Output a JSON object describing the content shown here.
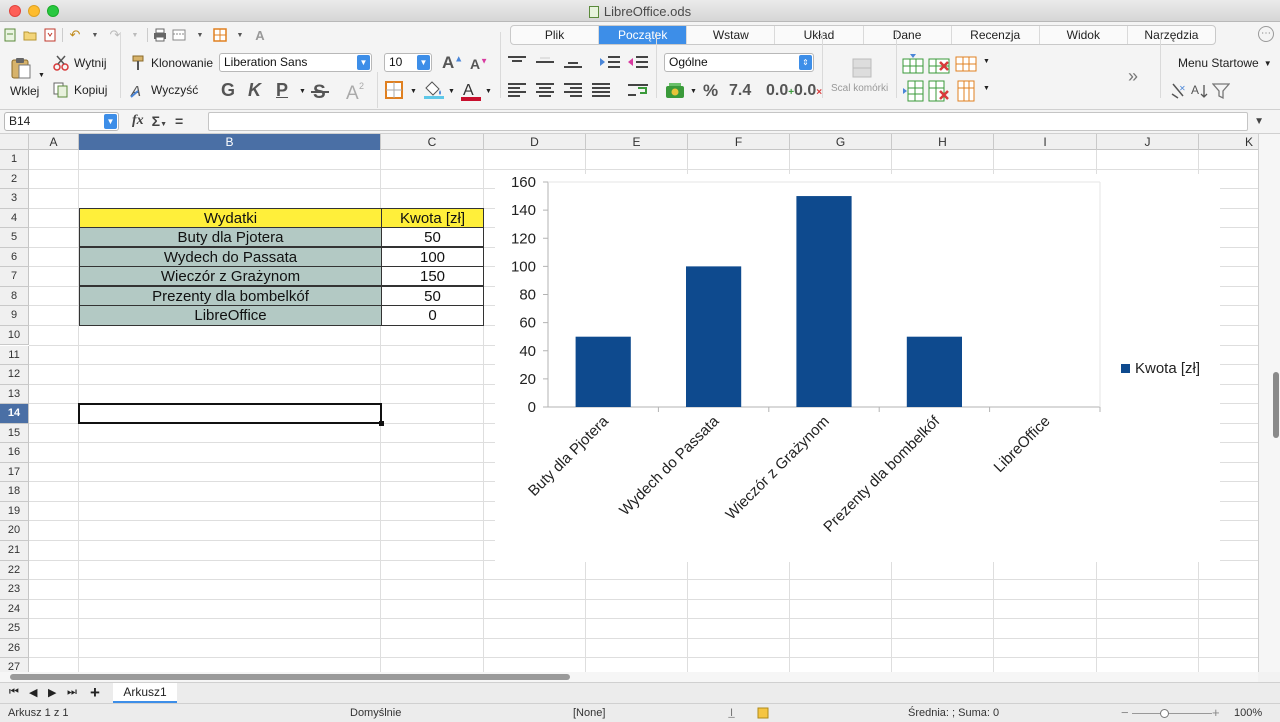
{
  "window": {
    "title": "LibreOffice.ods"
  },
  "tabs": [
    {
      "label": "Plik",
      "active": false
    },
    {
      "label": "Początek",
      "active": true
    },
    {
      "label": "Wstaw",
      "active": false
    },
    {
      "label": "Układ",
      "active": false
    },
    {
      "label": "Dane",
      "active": false
    },
    {
      "label": "Recenzja",
      "active": false
    },
    {
      "label": "Widok",
      "active": false
    },
    {
      "label": "Narzędzia",
      "active": false
    }
  ],
  "ribbon": {
    "paste_label": "Wklej",
    "cut_label": "Wytnij",
    "copy_label": "Kopiuj",
    "clone_label": "Klonowanie",
    "clear_label": "Wyczyść",
    "font_name": "Liberation Sans",
    "font_size": "10",
    "bold_glyph": "G",
    "italic_glyph": "K",
    "underline_glyph": "P",
    "number_format": "Ogólne",
    "percent_glyph": "%",
    "decimal_glyph": "7.4",
    "add_decimal_glyph": "0.0",
    "del_decimal_glyph": "0.0",
    "merge_label": "Scal komórki",
    "menu_start_label": "Menu Startowe",
    "more_glyph": "»"
  },
  "formula": {
    "cell_ref": "B14",
    "fx": "fx",
    "sigma": "Σ",
    "equals": "=",
    "content": ""
  },
  "grid": {
    "columns": [
      "A",
      "B",
      "C",
      "D",
      "E",
      "F",
      "G",
      "H",
      "I",
      "J",
      "K"
    ],
    "selected_column": "B",
    "rows": [
      "1",
      "2",
      "3",
      "4",
      "5",
      "6",
      "7",
      "8",
      "9",
      "10",
      "11",
      "12",
      "13",
      "14",
      "15",
      "16",
      "17",
      "18",
      "19",
      "20",
      "21",
      "22",
      "23",
      "24",
      "25",
      "26",
      "27"
    ],
    "selected_row": "14",
    "table": {
      "headers": [
        "Wydatki",
        "Kwota [zł]"
      ],
      "rows": [
        [
          "Buty dla Pjotera",
          "50"
        ],
        [
          "Wydech do Passata",
          "100"
        ],
        [
          "Wieczór z Grażynom",
          "150"
        ],
        [
          "Prezenty dla bombelkóf",
          "50"
        ],
        [
          "LibreOffice",
          "0"
        ]
      ]
    }
  },
  "chart_data": {
    "type": "bar",
    "categories": [
      "Buty dla Pjotera",
      "Wydech do Passata",
      "Wieczór z Grażynom",
      "Prezenty dla bombelkóf",
      "LibreOffice"
    ],
    "series": [
      {
        "name": "Kwota [zł]",
        "values": [
          50,
          100,
          150,
          50,
          0
        ],
        "color": "#0e4a8e"
      }
    ],
    "title": "",
    "xlabel": "",
    "ylabel": "",
    "ylim": [
      0,
      160
    ],
    "yticks": [
      0,
      20,
      40,
      60,
      80,
      100,
      120,
      140,
      160
    ],
    "grid": false,
    "legend": "right"
  },
  "sheets": {
    "tabs": [
      "Arkusz1"
    ],
    "active": "Arkusz1"
  },
  "status": {
    "sheet_info": "Arkusz 1 z 1",
    "page_style": "Domyślnie",
    "language": "[None]",
    "summary": "Średnia: ; Suma: 0",
    "zoom": "100%"
  }
}
